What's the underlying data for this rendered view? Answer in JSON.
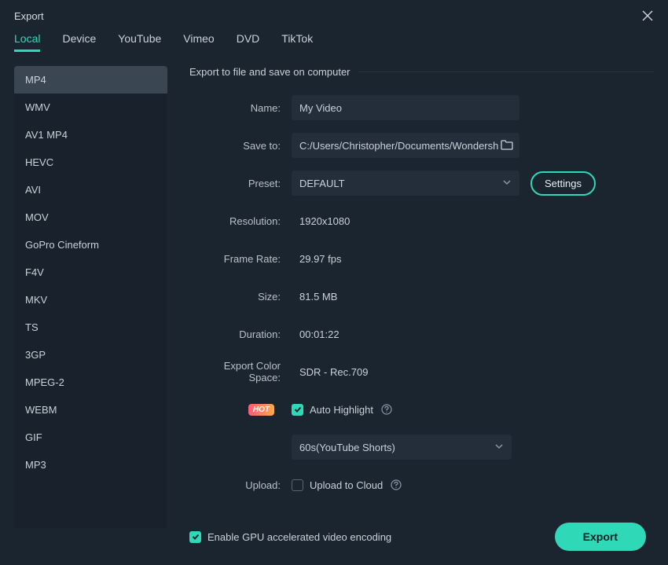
{
  "window": {
    "title": "Export"
  },
  "tabs": [
    {
      "label": "Local",
      "active": true
    },
    {
      "label": "Device",
      "active": false
    },
    {
      "label": "YouTube",
      "active": false
    },
    {
      "label": "Vimeo",
      "active": false
    },
    {
      "label": "DVD",
      "active": false
    },
    {
      "label": "TikTok",
      "active": false
    }
  ],
  "formats": [
    {
      "label": "MP4",
      "active": true
    },
    {
      "label": "WMV",
      "active": false
    },
    {
      "label": "AV1 MP4",
      "active": false
    },
    {
      "label": "HEVC",
      "active": false
    },
    {
      "label": "AVI",
      "active": false
    },
    {
      "label": "MOV",
      "active": false
    },
    {
      "label": "GoPro Cineform",
      "active": false
    },
    {
      "label": "F4V",
      "active": false
    },
    {
      "label": "MKV",
      "active": false
    },
    {
      "label": "TS",
      "active": false
    },
    {
      "label": "3GP",
      "active": false
    },
    {
      "label": "MPEG-2",
      "active": false
    },
    {
      "label": "WEBM",
      "active": false
    },
    {
      "label": "GIF",
      "active": false
    },
    {
      "label": "MP3",
      "active": false
    }
  ],
  "section": {
    "header": "Export to file and save on computer"
  },
  "form": {
    "name_label": "Name:",
    "name_value": "My Video",
    "saveto_label": "Save to:",
    "saveto_value": "C:/Users/Christopher/Documents/Wondersh",
    "preset_label": "Preset:",
    "preset_value": "DEFAULT",
    "settings_label": "Settings",
    "resolution_label": "Resolution:",
    "resolution_value": "1920x1080",
    "framerate_label": "Frame Rate:",
    "framerate_value": "29.97 fps",
    "size_label": "Size:",
    "size_value": "81.5 MB",
    "duration_label": "Duration:",
    "duration_value": "00:01:22",
    "colorspace_label": "Export Color Space:",
    "colorspace_value": "SDR - Rec.709",
    "hot_badge": "HOT",
    "autohighlight_label": "Auto Highlight",
    "highlight_preset": "60s(YouTube Shorts)",
    "upload_label": "Upload:",
    "upload_option": "Upload to Cloud"
  },
  "footer": {
    "gpu_label": "Enable GPU accelerated video encoding",
    "export_label": "Export"
  }
}
